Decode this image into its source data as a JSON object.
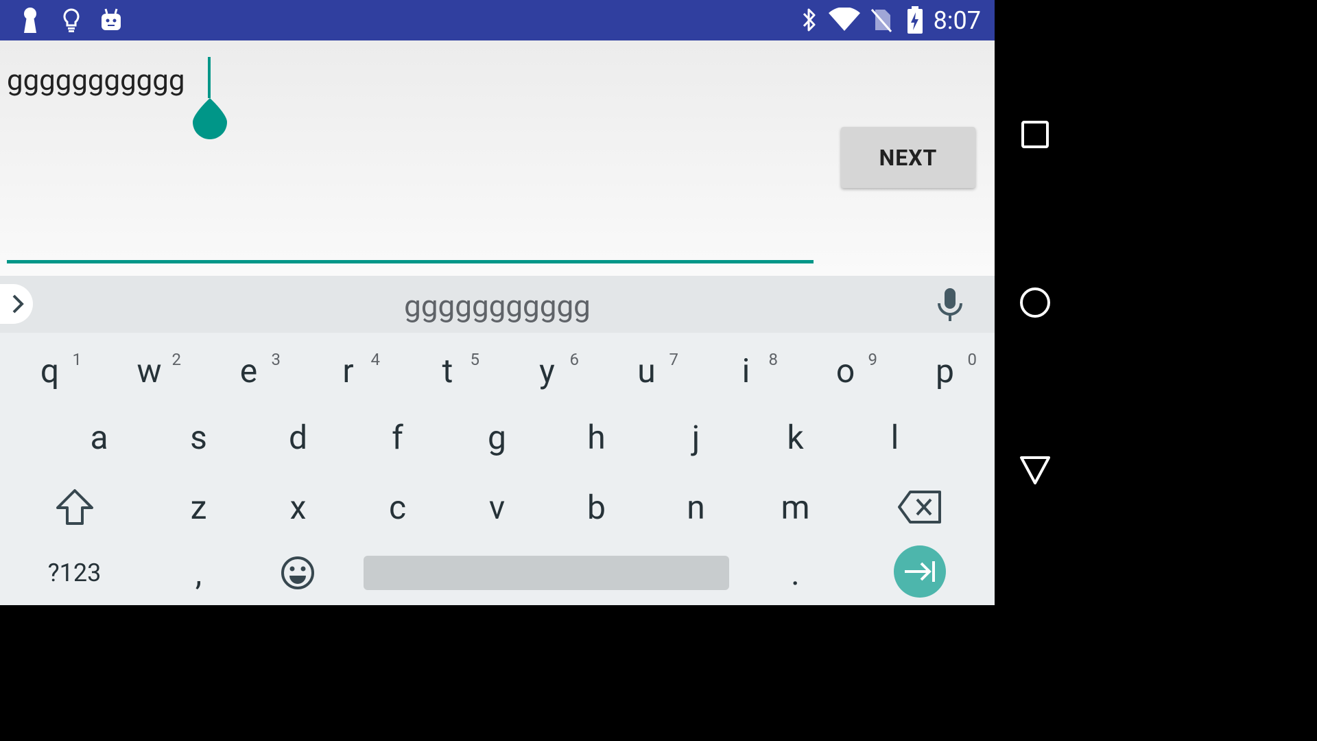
{
  "status_bar": {
    "time": "8:07",
    "left_icons": [
      "keyhole-icon",
      "lightbulb-icon",
      "android-icon"
    ],
    "right_icons": [
      "bluetooth-icon",
      "wifi-icon",
      "no-sim-icon",
      "battery-charging-icon"
    ]
  },
  "form": {
    "input_value": "ggggggggggg",
    "next_label": "NEXT"
  },
  "keyboard": {
    "suggestion": "ggggggggggg",
    "row1": [
      {
        "key": "q",
        "hint": "1"
      },
      {
        "key": "w",
        "hint": "2"
      },
      {
        "key": "e",
        "hint": "3"
      },
      {
        "key": "r",
        "hint": "4"
      },
      {
        "key": "t",
        "hint": "5"
      },
      {
        "key": "y",
        "hint": "6"
      },
      {
        "key": "u",
        "hint": "7"
      },
      {
        "key": "i",
        "hint": "8"
      },
      {
        "key": "o",
        "hint": "9"
      },
      {
        "key": "p",
        "hint": "0"
      }
    ],
    "row2": [
      "a",
      "s",
      "d",
      "f",
      "g",
      "h",
      "j",
      "k",
      "l"
    ],
    "row3": [
      "z",
      "x",
      "c",
      "v",
      "b",
      "n",
      "m"
    ],
    "symbols_label": "?123",
    "comma_label": ",",
    "period_label": "."
  },
  "colors": {
    "status_bar": "#303f9f",
    "accent": "#009688",
    "enter_key": "#4db6ac"
  },
  "navigation_bar": {
    "icons": [
      "recents-icon",
      "home-icon",
      "back-icon"
    ]
  }
}
